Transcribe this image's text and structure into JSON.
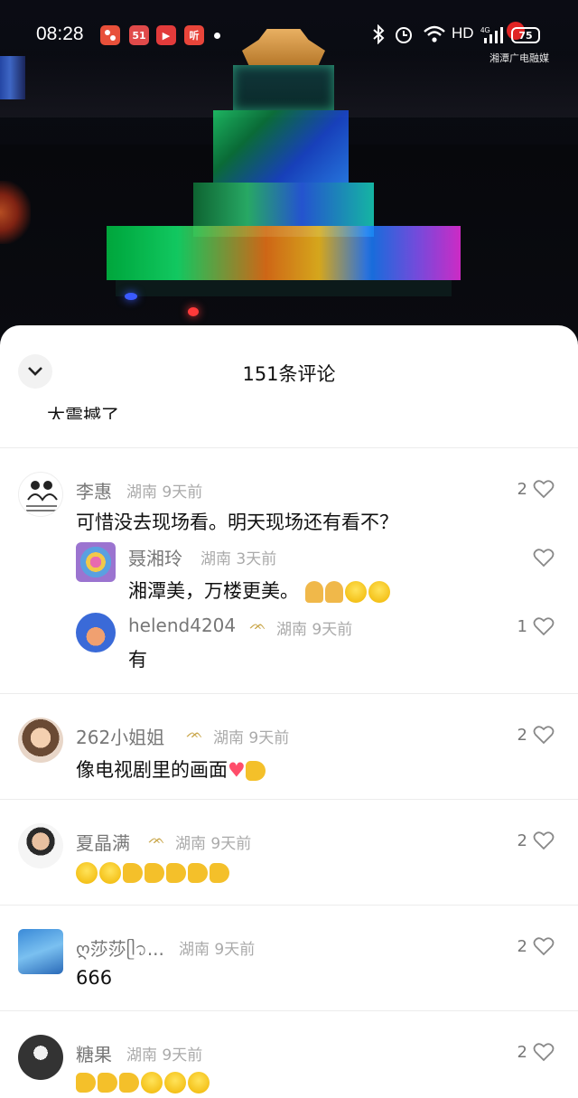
{
  "status_bar": {
    "time": "08:28",
    "apps": [
      "app-icon-1",
      "app-icon-2",
      "video-icon",
      "listen-icon"
    ],
    "app_labels": [
      "",
      "51",
      "▶",
      "听"
    ],
    "network": "HD",
    "signal": "4G",
    "battery": "75"
  },
  "video": {
    "watermark": "湘潭广电融媒"
  },
  "sheet": {
    "title": "151条评论",
    "cut_text": "太震撼了"
  },
  "comments": [
    {
      "user": "李惠",
      "meta": "湖南  9天前",
      "text": "可惜没去现场看。明天现场还有看不？",
      "likes": "2",
      "replies": [
        {
          "user": "聂湘玲",
          "meta": "湖南  3天前",
          "text": "湘潭美，万楼更美。",
          "likes": ""
        },
        {
          "user": "helend4204",
          "meta": "湖南  9天前",
          "text": "有",
          "likes": "1"
        }
      ]
    },
    {
      "user": "262小姐姐",
      "meta": "湖南  9天前",
      "text": "像电视剧里的画面",
      "likes": "2"
    },
    {
      "user": "夏晶满",
      "meta": "湖南  9天前",
      "text": "",
      "likes": "2"
    },
    {
      "user": "ღ莎莎ᥫ᭡...",
      "meta": "湖南  9天前",
      "text": "666",
      "likes": "2"
    },
    {
      "user": "糖果",
      "meta": "湖南  9天前",
      "text": "",
      "likes": "2"
    }
  ]
}
